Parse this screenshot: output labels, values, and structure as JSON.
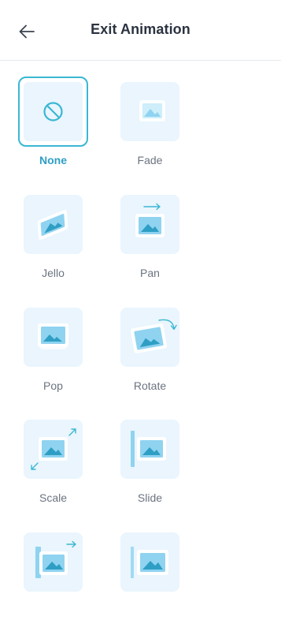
{
  "header": {
    "title": "Exit Animation",
    "back_icon": "arrow-left-icon"
  },
  "colors": {
    "accent": "#3ab7d3",
    "tile_bg": "#eaf5fd",
    "image_blue": "#8fd3f0"
  },
  "animations": [
    {
      "label": "None",
      "icon": "none-icon",
      "selected": true
    },
    {
      "label": "Fade",
      "icon": "fade-icon",
      "selected": false
    },
    {
      "label": "Jello",
      "icon": "jello-icon",
      "selected": false
    },
    {
      "label": "Pan",
      "icon": "pan-icon",
      "selected": false
    },
    {
      "label": "Pop",
      "icon": "pop-icon",
      "selected": false
    },
    {
      "label": "Rotate",
      "icon": "rotate-icon",
      "selected": false
    },
    {
      "label": "Scale",
      "icon": "scale-icon",
      "selected": false
    },
    {
      "label": "Slide",
      "icon": "slide-icon",
      "selected": false
    },
    {
      "label": "",
      "icon": "wipe-icon",
      "selected": false
    },
    {
      "label": "",
      "icon": "slide-reveal-icon",
      "selected": false
    }
  ]
}
